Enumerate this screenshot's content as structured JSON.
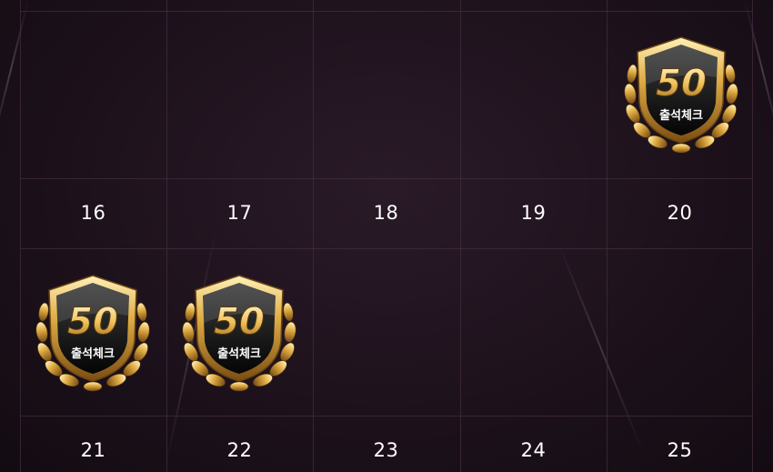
{
  "calendar": {
    "date_row_1": [
      "16",
      "17",
      "18",
      "19",
      "20"
    ],
    "date_row_2": [
      "21",
      "22",
      "23",
      "24",
      "25"
    ]
  },
  "badges": [
    {
      "day": "20",
      "value": "50",
      "label": "출석체크"
    },
    {
      "day": "21",
      "value": "50",
      "label": "출석체크"
    },
    {
      "day": "22",
      "value": "50",
      "label": "출석체크"
    }
  ],
  "colors": {
    "background": "#1c111b",
    "grid_line": "#46293f",
    "gold": "#d9a53a",
    "badge_dark": "#111111",
    "date_text": "#ffffff"
  }
}
